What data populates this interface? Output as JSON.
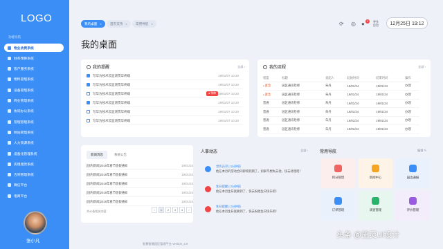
{
  "app": {
    "logo": "LOGO"
  },
  "sidebar": {
    "caption": "功能导航",
    "items": [
      {
        "label": "物业收费系统"
      },
      {
        "label": "财务预算系统"
      },
      {
        "label": "客户服务系统"
      },
      {
        "label": "物料管理系统"
      },
      {
        "label": "设备管理系统"
      },
      {
        "label": "商业管理系统"
      },
      {
        "label": "协同办公系统"
      },
      {
        "label": "管理管理系统"
      },
      {
        "label": "网站管理系统"
      },
      {
        "label": "人力资源系统"
      },
      {
        "label": "设备化管理系统"
      },
      {
        "label": "房租租赁系统"
      },
      {
        "label": "合同管理系统"
      },
      {
        "label": "微信平台"
      },
      {
        "label": "电商平台"
      }
    ],
    "user": {
      "name": "张小凡"
    }
  },
  "header": {
    "tabs": [
      {
        "label": "我的桌面"
      },
      {
        "label": "首页支持"
      },
      {
        "label": "常用导航"
      }
    ],
    "badge_count": "3",
    "grid_label": "更多 应用",
    "datetime": "12月25日 19:12"
  },
  "page": {
    "title": "我的桌面"
  },
  "reminders": {
    "title": "我的提醒",
    "more": "全部 ›",
    "items": [
      {
        "text": "写华为技术云监测贯华终端",
        "date": "19/01/07 10:20",
        "checked": true,
        "tag": ""
      },
      {
        "text": "写华为技术云监测贯华终端",
        "date": "19/01/07 10:20",
        "checked": true,
        "tag": ""
      },
      {
        "text": "写华为技术云监测贯华终端",
        "date": "19/01/07 10:20",
        "checked": false,
        "tag": "● 待审"
      },
      {
        "text": "写华为技术云监测贯华终端",
        "date": "19/01/07 10:20",
        "checked": true,
        "tag": ""
      },
      {
        "text": "写华为技术云监测贯华终端",
        "date": "19/01/07 10:20",
        "checked": false,
        "tag": ""
      },
      {
        "text": "写华为技术云监测贯华终端",
        "date": "19/01/07 10:20",
        "checked": false,
        "tag": ""
      }
    ]
  },
  "flow": {
    "title": "我的流程",
    "more": "全部 ›",
    "headers": [
      "程度",
      "标题",
      "发起人",
      "起始时间",
      "结束时间",
      "操作"
    ],
    "rows": [
      {
        "level": "紧急",
        "title": "园区通讯检修",
        "initiator": "朱丹",
        "start": "19/01/24",
        "end": "19/01/24",
        "action": "办理",
        "urgent": true
      },
      {
        "level": "紧急",
        "title": "园区通讯检修",
        "initiator": "朱丹",
        "start": "19/01/24",
        "end": "19/01/24",
        "action": "办理",
        "urgent": true
      },
      {
        "level": "普通",
        "title": "园区通讯检修",
        "initiator": "朱丹",
        "start": "19/01/24",
        "end": "19/01/24",
        "action": "办理",
        "urgent": false
      },
      {
        "level": "普通",
        "title": "园区通讯检修",
        "initiator": "朱丹",
        "start": "19/01/24",
        "end": "19/01/24",
        "action": "办理",
        "urgent": false
      },
      {
        "level": "普通",
        "title": "园区通讯检修",
        "initiator": "朱丹",
        "start": "19/01/24",
        "end": "19/01/24",
        "action": "办理",
        "urgent": false
      },
      {
        "level": "普通",
        "title": "园区通讯检修",
        "initiator": "朱丹",
        "start": "19/01/24",
        "end": "19/01/24",
        "action": "办理",
        "urgent": false
      }
    ]
  },
  "news": {
    "tabs": [
      {
        "label": "新闻消息"
      },
      {
        "label": "系统公告"
      }
    ],
    "items": [
      {
        "text": "[国内新闻]2019年春节放假通知",
        "date": "19/01/24"
      },
      {
        "text": "[国内新闻]2019年春节放假通知",
        "date": "19/01/24"
      },
      {
        "text": "[国内新闻]2019年春节放假通知",
        "date": "19/01/24"
      },
      {
        "text": "[国内新闻]2019年春节放假通知",
        "date": "19/01/24"
      },
      {
        "text": "[国内新闻]2019年春节放假通知",
        "date": "19/01/24"
      }
    ],
    "total": "共40条相关内容",
    "pages": [
      "‹",
      "1",
      "2",
      "3",
      "4",
      "›"
    ]
  },
  "activity": {
    "title": "人事动态",
    "more": "全部 ›",
    "items": [
      {
        "line1": "党务员邓 | 2分钟前",
        "line2": "他在本月的劳动合同即将到期了，如果不想失去他，快去处理吧！",
        "color": "#3b8ef5"
      },
      {
        "line1": "生日提醒 | 2分钟前",
        "line2": "他在本月生日就要到了，快去祝他生日快乐吧！",
        "color": "#f04545"
      },
      {
        "line1": "生日提醒 | 2分钟前",
        "line2": "他在本月生日就要到了，快去祝他生日快乐吧！",
        "color": "#f04545"
      }
    ]
  },
  "quicknav": {
    "title": "常用导航",
    "edit": "编辑",
    "tiles": [
      {
        "label": "积分管理",
        "bg": "#fdeeee",
        "icon": "#f06464"
      },
      {
        "label": "新闻中心",
        "bg": "#fdf3e6",
        "icon": "#f5a623"
      },
      {
        "label": "园边通报",
        "bg": "#e9f1fd",
        "icon": "#3b8ef5"
      },
      {
        "label": "订单管理",
        "bg": "#e9f1fd",
        "icon": "#3b8ef5"
      },
      {
        "label": "调查管理",
        "bg": "#e7f6ee",
        "icon": "#27b36a"
      },
      {
        "label": "评价管理",
        "bg": "#f2ecfb",
        "icon": "#9a5be0"
      }
    ]
  },
  "footer": {
    "text": "智慧智慧园区管理平台 Version_2.0"
  },
  "watermark": "头条 @施灵UI设计"
}
